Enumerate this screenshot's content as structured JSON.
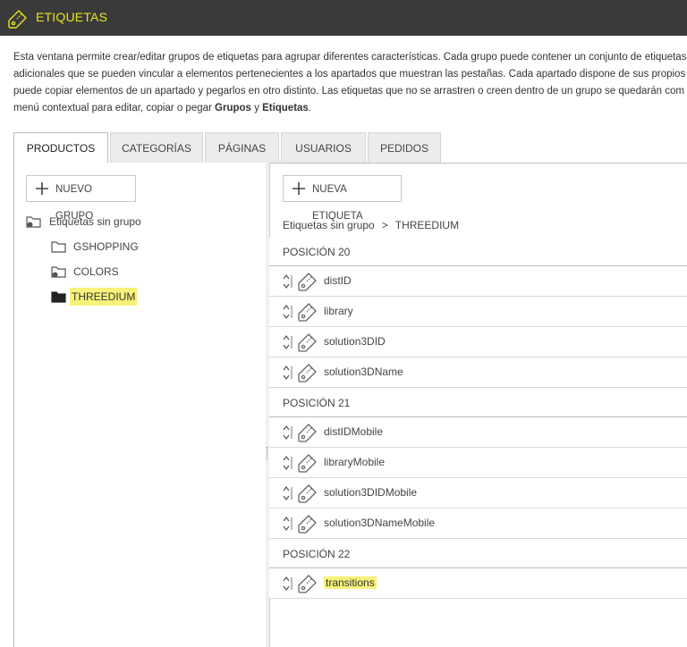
{
  "header": {
    "title": "ETIQUETAS",
    "icon": "tag-icon"
  },
  "description": {
    "line1": "Esta ventana permite crear/editar grupos de etiquetas para agrupar diferentes características. Cada grupo puede contener un conjunto de etiquetas",
    "line2": "adicionales que se pueden vincular a elementos pertenecientes a los apartados que muestran las pestañas. Cada apartado dispone de sus propios g",
    "line3": "puede copiar elementos de un apartado y pegarlos en otro distinto. Las etiquetas que no se arrastren o creen dentro de un grupo se quedarán com",
    "line4_a": "menú contextual para editar, copiar o pegar ",
    "line4_b": "Grupos",
    "line4_c": " y ",
    "line4_d": "Etiquetas",
    "line4_e": "."
  },
  "tabs": [
    "PRODUCTOS",
    "CATEGORÍAS",
    "PÁGINAS",
    "USUARIOS",
    "PEDIDOS"
  ],
  "left": {
    "new_group_label": "NUEVO GRUPO",
    "tree": {
      "root": "Etiquetas sin grupo",
      "children": [
        "GSHOPPING",
        "COLORS",
        "THREEDIUM"
      ]
    }
  },
  "right": {
    "new_tag_label": "NUEVA ETIQUETA",
    "breadcrumb": {
      "root": "Etiquetas sin grupo",
      "separator": ">",
      "current": "THREEDIUM"
    },
    "groups": [
      {
        "title": "POSICIÓN 20",
        "tags": [
          "distID",
          "library",
          "solution3DID",
          "solution3DName"
        ]
      },
      {
        "title": "POSICIÓN 21",
        "tags": [
          "distIDMobile",
          "libraryMobile",
          "solution3DIDMobile",
          "solution3DNameMobile"
        ]
      },
      {
        "title": "POSICIÓN 22",
        "tags": [
          "transitions"
        ]
      }
    ]
  },
  "colors": {
    "titlebar": "#3a3a3a",
    "accent": "#e5e51e",
    "highlight": "#f7f27a"
  }
}
